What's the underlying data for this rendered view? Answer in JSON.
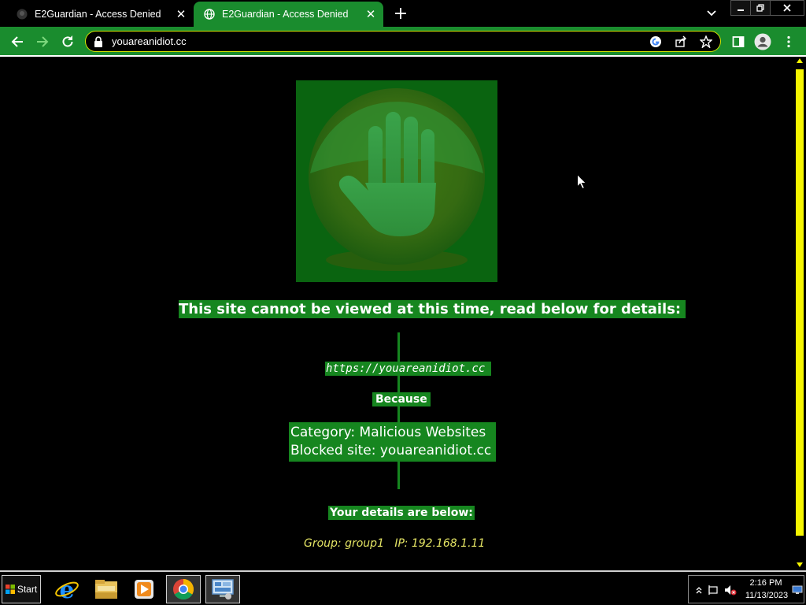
{
  "browser": {
    "tabs": [
      {
        "title": "E2Guardian - Access Denied",
        "active": false
      },
      {
        "title": "E2Guardian - Access Denied",
        "active": true
      }
    ],
    "close_glyph": "✕",
    "new_tab_glyph": "+",
    "address": "youareanidiot.cc",
    "accent_color": "#1a8c2e",
    "omnibox_border_color": "#d6e600"
  },
  "page": {
    "headline": "This site cannot be viewed at this time, read below for details:",
    "blocked_url": "https://youareanidiot.cc",
    "because_label": "Because",
    "category_line": "Category: Malicious Websites",
    "blocked_site_line": "Blocked site: youareanidiot.cc",
    "details_heading": "Your details are below:",
    "details_line": "Group: group1   IP: 192.168.1.11",
    "banner_color": "#16861f",
    "details_color": "#e4e464",
    "scrollbar_color": "#f5f500"
  },
  "taskbar": {
    "start_label": "Start",
    "apps": [
      "internet-explorer",
      "file-explorer",
      "media-player",
      "chrome",
      "control-panel"
    ],
    "clock_time": "2:16 PM",
    "clock_date": "11/13/2023"
  }
}
